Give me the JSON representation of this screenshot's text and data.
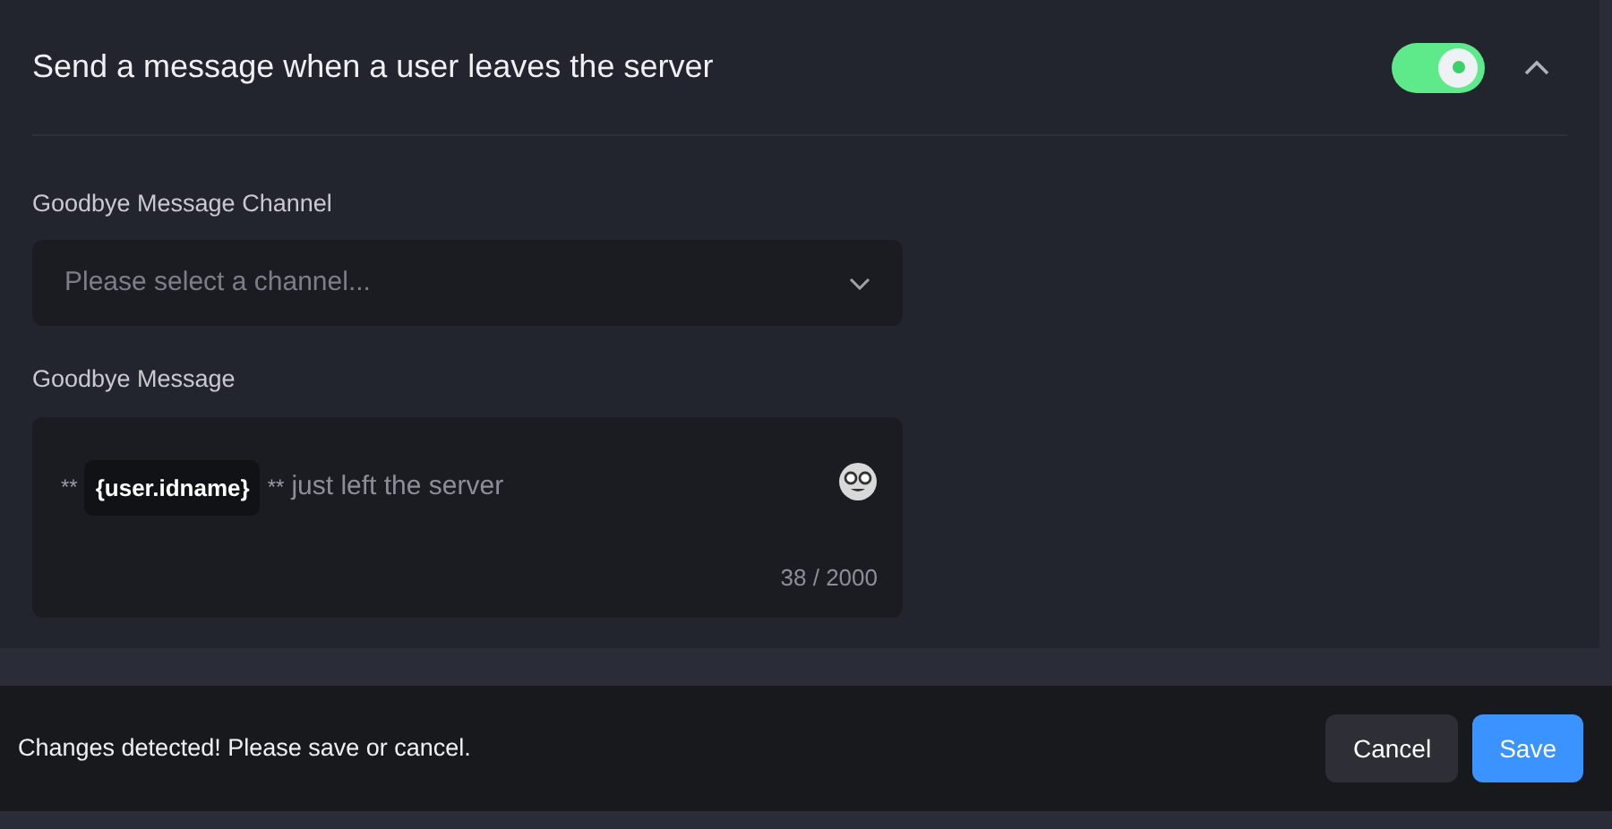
{
  "section": {
    "title": "Send a message when a user leaves the server",
    "enabled": true,
    "expanded": true
  },
  "channel_field": {
    "label": "Goodbye Message Channel",
    "placeholder": "Please select a channel..."
  },
  "message_field": {
    "label": "Goodbye Message",
    "segments": [
      {
        "kind": "text",
        "text": "**"
      },
      {
        "kind": "variable",
        "text": "{user.idname}"
      },
      {
        "kind": "text",
        "text": "**"
      },
      {
        "kind": "plain",
        "text": "just left the server"
      }
    ],
    "counter": "38 / 2000"
  },
  "save_bar": {
    "message": "Changes detected! Please save or cancel.",
    "buttons": [
      {
        "label": "Cancel",
        "kind": "secondary"
      },
      {
        "label": "Save",
        "kind": "primary"
      }
    ]
  }
}
